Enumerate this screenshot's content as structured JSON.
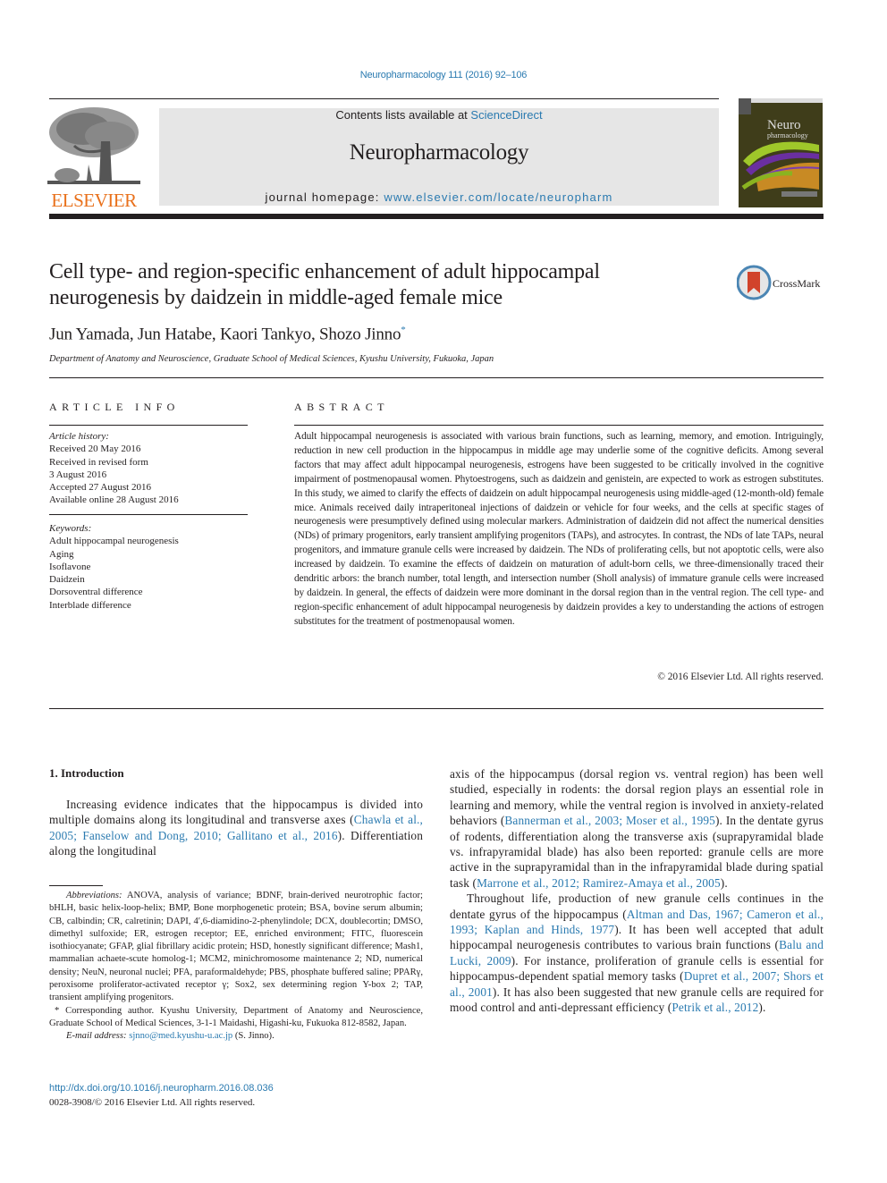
{
  "header": {
    "journal_ref": "Neuropharmacology 111 (2016) 92–106",
    "contents_prefix": "Contents lists available at ",
    "contents_link": "ScienceDirect",
    "journal_name": "Neuropharmacology",
    "homepage_prefix": "journal homepage: ",
    "homepage_link": "www.elsevier.com/locate/neuropharm",
    "publisher": "ELSEVIER",
    "cover_title_1": "Neuro",
    "cover_title_2": "pharmacology",
    "crossmark_label": "CrossMark"
  },
  "article": {
    "title_line1": "Cell type- and region-specific enhancement of adult hippocampal",
    "title_line2": "neurogenesis by daidzein in middle-aged female mice",
    "authors": "Jun Yamada, Jun Hatabe, Kaori Tankyo, Shozo Jinno",
    "author_mark": "*",
    "affiliation": "Department of Anatomy and Neuroscience, Graduate School of Medical Sciences, Kyushu University, Fukuoka, Japan"
  },
  "article_info": {
    "heading": "ARTICLE INFO",
    "history_label": "Article history:",
    "history": [
      "Received 20 May 2016",
      "Received in revised form",
      "3 August 2016",
      "Accepted 27 August 2016",
      "Available online 28 August 2016"
    ],
    "keywords_label": "Keywords:",
    "keywords": [
      "Adult hippocampal neurogenesis",
      "Aging",
      "Isoflavone",
      "Daidzein",
      "Dorsoventral difference",
      "Interblade difference"
    ]
  },
  "abstract": {
    "heading": "ABSTRACT",
    "text": "Adult hippocampal neurogenesis is associated with various brain functions, such as learning, memory, and emotion. Intriguingly, reduction in new cell production in the hippocampus in middle age may underlie some of the cognitive deficits. Among several factors that may affect adult hippocampal neurogenesis, estrogens have been suggested to be critically involved in the cognitive impairment of postmenopausal women. Phytoestrogens, such as daidzein and genistein, are expected to work as estrogen substitutes. In this study, we aimed to clarify the effects of daidzein on adult hippocampal neurogenesis using middle-aged (12-month-old) female mice. Animals received daily intraperitoneal injections of daidzein or vehicle for four weeks, and the cells at specific stages of neurogenesis were presumptively defined using molecular markers. Administration of daidzein did not affect the numerical densities (NDs) of primary progenitors, early transient amplifying progenitors (TAPs), and astrocytes. In contrast, the NDs of late TAPs, neural progenitors, and immature granule cells were increased by daidzein. The NDs of proliferating cells, but not apoptotic cells, were also increased by daidzein. To examine the effects of daidzein on maturation of adult-born cells, we three-dimensionally traced their dendritic arbors: the branch number, total length, and intersection number (Sholl analysis) of immature granule cells were increased by daidzein. In general, the effects of daidzein were more dominant in the dorsal region than in the ventral region. The cell type- and region-specific enhancement of adult hippocampal neurogenesis by daidzein provides a key to understanding the actions of estrogen substitutes for the treatment of postmenopausal women.",
    "copyright": "© 2016 Elsevier Ltd. All rights reserved."
  },
  "intro": {
    "heading": "1.  Introduction",
    "left_p1_a": "Increasing evidence indicates that the hippocampus is divided into multiple domains along its longitudinal and transverse axes (",
    "left_p1_cite": "Chawla et al., 2005; Fanselow and Dong, 2010; Gallitano et al., 2016",
    "left_p1_b": "). Differentiation along the longitudinal",
    "right_p1_a": "axis of the hippocampus (dorsal region vs. ventral region) has been well studied, especially in rodents: the dorsal region plays an essential role in learning and memory, while the ventral region is involved in anxiety-related behaviors (",
    "right_p1_cite1": "Bannerman et al., 2003; Moser et al., 1995",
    "right_p1_b": "). In the dentate gyrus of rodents, differentiation along the transverse axis (suprapyramidal blade vs. infrapyramidal blade) has also been reported: granule cells are more active in the suprapyramidal than in the infrapyramidal blade during spatial task (",
    "right_p1_cite2": "Marrone et al., 2012; Ramirez-Amaya et al., 2005",
    "right_p1_c": ").",
    "right_p2_a": "Throughout life, production of new granule cells continues in the dentate gyrus of the hippocampus (",
    "right_p2_cite1": "Altman and Das, 1967; Cameron et al., 1993; Kaplan and Hinds, 1977",
    "right_p2_b": "). It has been well accepted that adult hippocampal neurogenesis contributes to various brain functions (",
    "right_p2_cite2": "Balu and Lucki, 2009",
    "right_p2_c": "). For instance, proliferation of granule cells is essential for hippocampus-dependent spatial memory tasks (",
    "right_p2_cite3": "Dupret et al., 2007; Shors et al., 2001",
    "right_p2_d": "). It has also been suggested that new granule cells are required for mood control and anti-depressant efficiency (",
    "right_p2_cite4": "Petrik et al., 2012",
    "right_p2_e": ")."
  },
  "footnotes": {
    "abbrev_label": "Abbreviations:",
    "abbrev_text": " ANOVA, analysis of variance; BDNF, brain-derived neurotrophic factor; bHLH, basic helix-loop-helix; BMP, Bone morphogenetic protein; BSA, bovine serum albumin; CB, calbindin; CR, calretinin; DAPI, 4′,6-diamidino-2-phenylindole; DCX, doublecortin; DMSO, dimethyl sulfoxide; ER, estrogen receptor; EE, enriched environment; FITC, fluorescein isothiocyanate; GFAP, glial fibrillary acidic protein; HSD, honestly significant difference; Mash1, mammalian achaete-scute homolog-1; MCM2, minichromosome maintenance 2; ND, numerical density; NeuN, neuronal nuclei; PFA, paraformaldehyde; PBS, phosphate buffered saline; PPARγ, peroxisome proliferator-activated receptor γ; Sox2, sex determining region Y-box 2; TAP, transient amplifying progenitors.",
    "corresponding": "* Corresponding author. Kyushu University, Department of Anatomy and Neuroscience, Graduate School of Medical Sciences, 3-1-1 Maidashi, Higashi-ku, Fukuoka 812-8582, Japan.",
    "email_label": "E-mail address:",
    "email": "sjnno@med.kyushu-u.ac.jp",
    "email_suffix": " (S. Jinno).",
    "doi": "http://dx.doi.org/10.1016/j.neuropharm.2016.08.036",
    "issn": "0028-3908/© 2016 Elsevier Ltd. All rights reserved."
  },
  "colors": {
    "link": "#2a7ab0",
    "elsevier_orange": "#e9711c",
    "banner_gray": "#e6e6e6",
    "text": "#231f20"
  }
}
